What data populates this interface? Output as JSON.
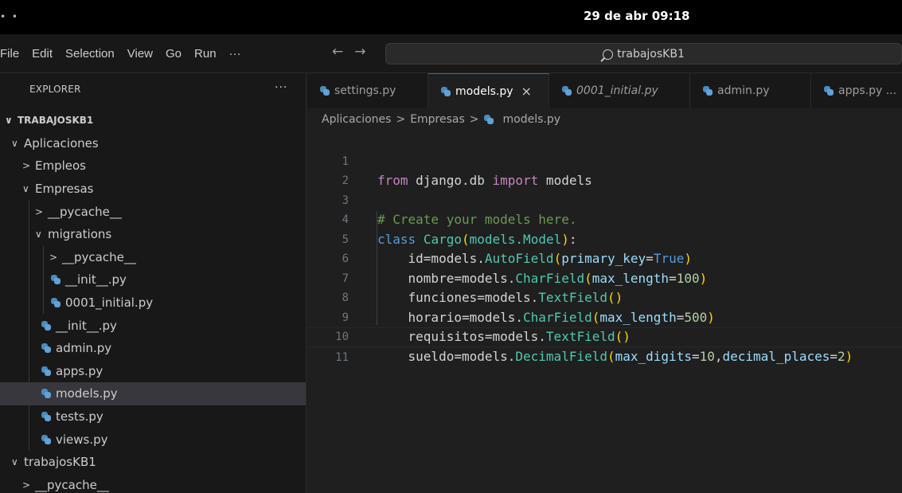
{
  "system_bar": {
    "dots": "• •",
    "clock": "29 de abr  09:18"
  },
  "menu": [
    "File",
    "Edit",
    "Selection",
    "View",
    "Go",
    "Run",
    "···"
  ],
  "nav": {
    "back": "←",
    "forward": "→"
  },
  "search": {
    "text": "trabajosKB1"
  },
  "sidebar": {
    "title": "EXPLORER",
    "more": "···",
    "items": [
      {
        "label": "TRABAJOSKB1",
        "chevron": "∨",
        "depth": 0
      },
      {
        "label": "Aplicaciones",
        "chevron": "∨",
        "depth": 1
      },
      {
        "label": "Empleos",
        "chevron": ">",
        "depth": 2
      },
      {
        "label": "Empresas",
        "chevron": "∨",
        "depth": 2
      },
      {
        "label": "__pycache__",
        "chevron": ">",
        "depth": 3
      },
      {
        "label": "migrations",
        "chevron": "∨",
        "depth": 3
      },
      {
        "label": "__pycache__",
        "chevron": ">",
        "depth": 4
      },
      {
        "label": "__init__.py",
        "depth": 4
      },
      {
        "label": "0001_initial.py",
        "depth": 4
      },
      {
        "label": "__init__.py",
        "depth": 3
      },
      {
        "label": "admin.py",
        "depth": 3
      },
      {
        "label": "apps.py",
        "depth": 3
      },
      {
        "label": "models.py",
        "depth": 3
      },
      {
        "label": "tests.py",
        "depth": 3
      },
      {
        "label": "views.py",
        "depth": 3
      },
      {
        "label": "trabajosKB1",
        "chevron": "∨",
        "depth": 1
      },
      {
        "label": "__pycache__",
        "chevron": ">",
        "depth": 2
      }
    ]
  },
  "tabs": [
    {
      "label": "settings.py"
    },
    {
      "label": "models.py",
      "close": "×"
    },
    {
      "label": "0001_initial.py"
    },
    {
      "label": "admin.py"
    },
    {
      "label": "apps.py ..."
    }
  ],
  "breadcrumb": {
    "part1": "Aplicaciones",
    "sep": ">",
    "part2": "Empresas",
    "file": "models.py"
  },
  "editor": {
    "line_numbers": [
      "1",
      "2",
      "3",
      "4",
      "5",
      "6",
      "7",
      "8",
      "9",
      "10",
      "11"
    ],
    "l1": {
      "from": "from",
      "mod": " django.db ",
      "imp": "import",
      "rest": " models"
    },
    "l3": {
      "comment": "# Create your models here."
    },
    "l4": {
      "cls": "class",
      "name": "Cargo",
      "p1": "(",
      "base": "models.Model",
      "p2": ")",
      "colon": ":"
    },
    "l5": {
      "lead": "    id=models.",
      "fn": "AutoField",
      "o": "(",
      "prm": "primary_key",
      "eq": "=",
      "val": "True",
      "c": ")"
    },
    "l6": {
      "lead": "    nombre=models.",
      "fn": "CharField",
      "o": "(",
      "prm": "max_length",
      "eq": "=",
      "val": "100",
      "c": ")"
    },
    "l7": {
      "lead": "    funciones=models.",
      "fn": "TextField",
      "o": "(",
      "c": ")"
    },
    "l8": {
      "lead": "    horario=models.",
      "fn": "CharField",
      "o": "(",
      "prm": "max_length",
      "eq": "=",
      "val": "500",
      "c": ")"
    },
    "l9": {
      "lead": "    requisitos=models.",
      "fn": "TextField",
      "o": "(",
      "c": ")"
    },
    "l10": {
      "lead": "    sueldo=models.",
      "fn": "DecimalField",
      "o": "(",
      "prm": "max_digits",
      "eq": "=",
      "val": "10",
      "comma": ",",
      "prm2": "decimal_places",
      "eq2": "=",
      "val2": "2",
      "c": ")"
    }
  }
}
